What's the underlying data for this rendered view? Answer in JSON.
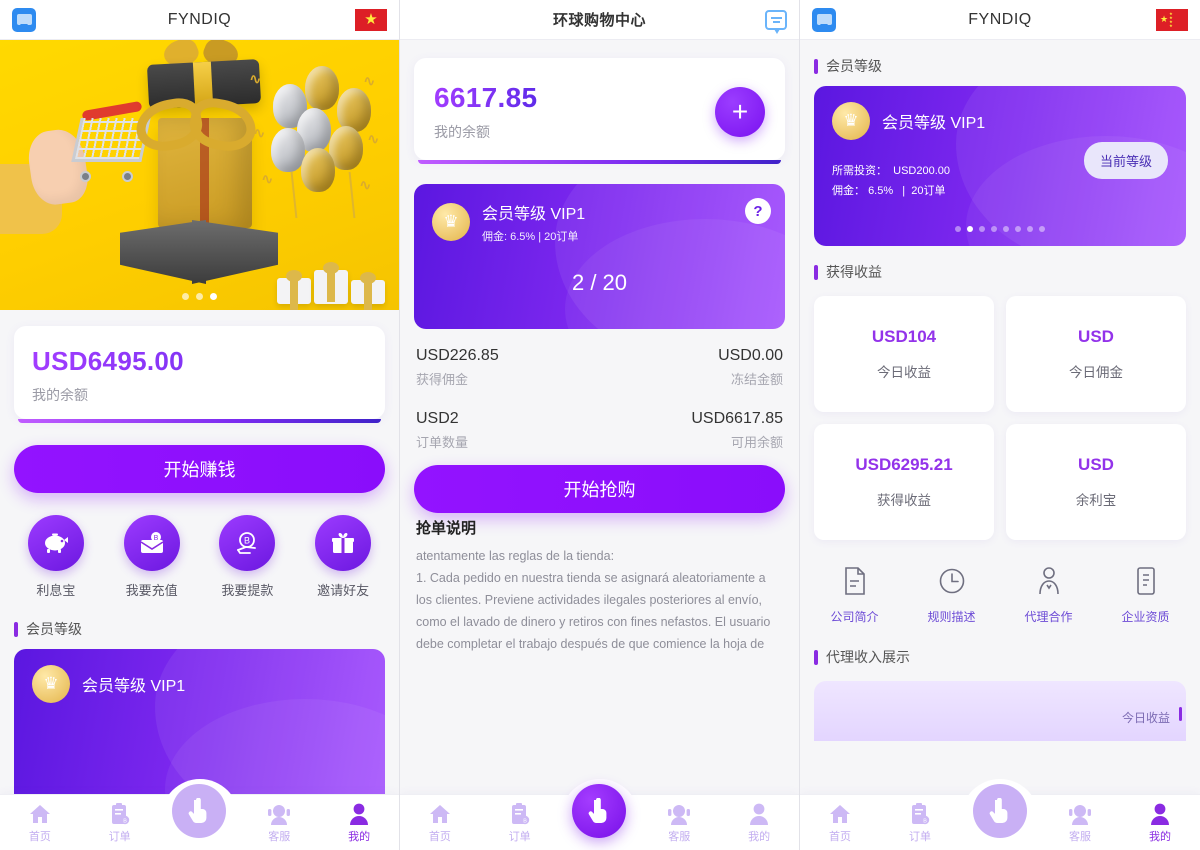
{
  "screen1": {
    "header": {
      "title": "FYNDIQ",
      "left_icon": "message-icon",
      "flag": "vietnam-flag"
    },
    "banner": {
      "dots": 3,
      "active_dot": 3
    },
    "balance": {
      "amount": "USD6495.00",
      "label": "我的余额"
    },
    "cta": "开始赚钱",
    "quick_actions": [
      {
        "label": "利息宝",
        "icon": "piggy-bank-icon"
      },
      {
        "label": "我要充值",
        "icon": "envelope-coin-icon"
      },
      {
        "label": "我要提款",
        "icon": "withdraw-hand-icon"
      },
      {
        "label": "邀请好友",
        "icon": "gift-icon"
      }
    ],
    "section": "会员等级",
    "vip": {
      "name": "会员等级 VIP1"
    }
  },
  "screen2": {
    "header": {
      "title": "环球购物中心",
      "right_icon": "chat-icon"
    },
    "balance": {
      "amount": "6617.85",
      "label": "我的余额",
      "add_icon": "plus-icon"
    },
    "vip": {
      "name": "会员等级 VIP1",
      "sub": "佣金: 6.5% | 20订单",
      "progress": "2 / 20",
      "help_icon": "question-mark-icon"
    },
    "stats": [
      {
        "value": "USD226.85",
        "label": "获得佣金"
      },
      {
        "value": "USD0.00",
        "label": "冻结金额"
      },
      {
        "value": "USD2",
        "label": "订单数量"
      },
      {
        "value": "USD6617.85",
        "label": "可用余额"
      }
    ],
    "cta": "开始抢购",
    "rules": {
      "title": "抢单说明",
      "body": " atentamente las reglas de la tienda:\n1. Cada pedido en nuestra tienda se asignará aleatoriamente a los clientes. Previene actividades ilegales posteriores al envío, como el lavado de dinero y retiros con fines nefastos. El usuario debe completar el trabajo después de que comience la hoja de"
    }
  },
  "screen3": {
    "header": {
      "title": "FYNDIQ",
      "left_icon": "message-icon",
      "flag": "china-flag"
    },
    "section_level": "会员等级",
    "vip": {
      "name": "会员等级 VIP1",
      "invest_label": "所需投资：",
      "invest_value": "USD200.00",
      "commission_label": "佣金：",
      "commission_value": "6.5%",
      "orders_value": "20订单",
      "badge": "当前等级",
      "dots": 8,
      "active_dot": 2
    },
    "section_earn": "获得收益",
    "earn_cells": [
      {
        "value": "USD104",
        "label": "今日收益"
      },
      {
        "value": "USD",
        "label": "今日佣金"
      },
      {
        "value": "USD6295.21",
        "label": "获得收益"
      },
      {
        "value": "USD",
        "label": "余利宝"
      }
    ],
    "entries": [
      {
        "label": "公司简介",
        "icon": "document-icon"
      },
      {
        "label": "规则描述",
        "icon": "clock-icon"
      },
      {
        "label": "代理合作",
        "icon": "person-handshake-icon"
      },
      {
        "label": "企业资质",
        "icon": "certificate-icon"
      }
    ],
    "section_agent": "代理收入展示",
    "agent_partial": "今日收益"
  },
  "nav": {
    "items": [
      {
        "label": "首页",
        "icon": "home-icon"
      },
      {
        "label": "订单",
        "icon": "clipboard-icon"
      },
      {
        "label": "",
        "icon": "tap-hand-icon"
      },
      {
        "label": "客服",
        "icon": "headset-icon"
      },
      {
        "label": "我的",
        "icon": "user-icon"
      }
    ]
  },
  "colors": {
    "accent": "#8a2be2",
    "accent_deep": "#5b17e0",
    "banner_yellow": "#ffd900",
    "muted": "#9a9aa5"
  }
}
